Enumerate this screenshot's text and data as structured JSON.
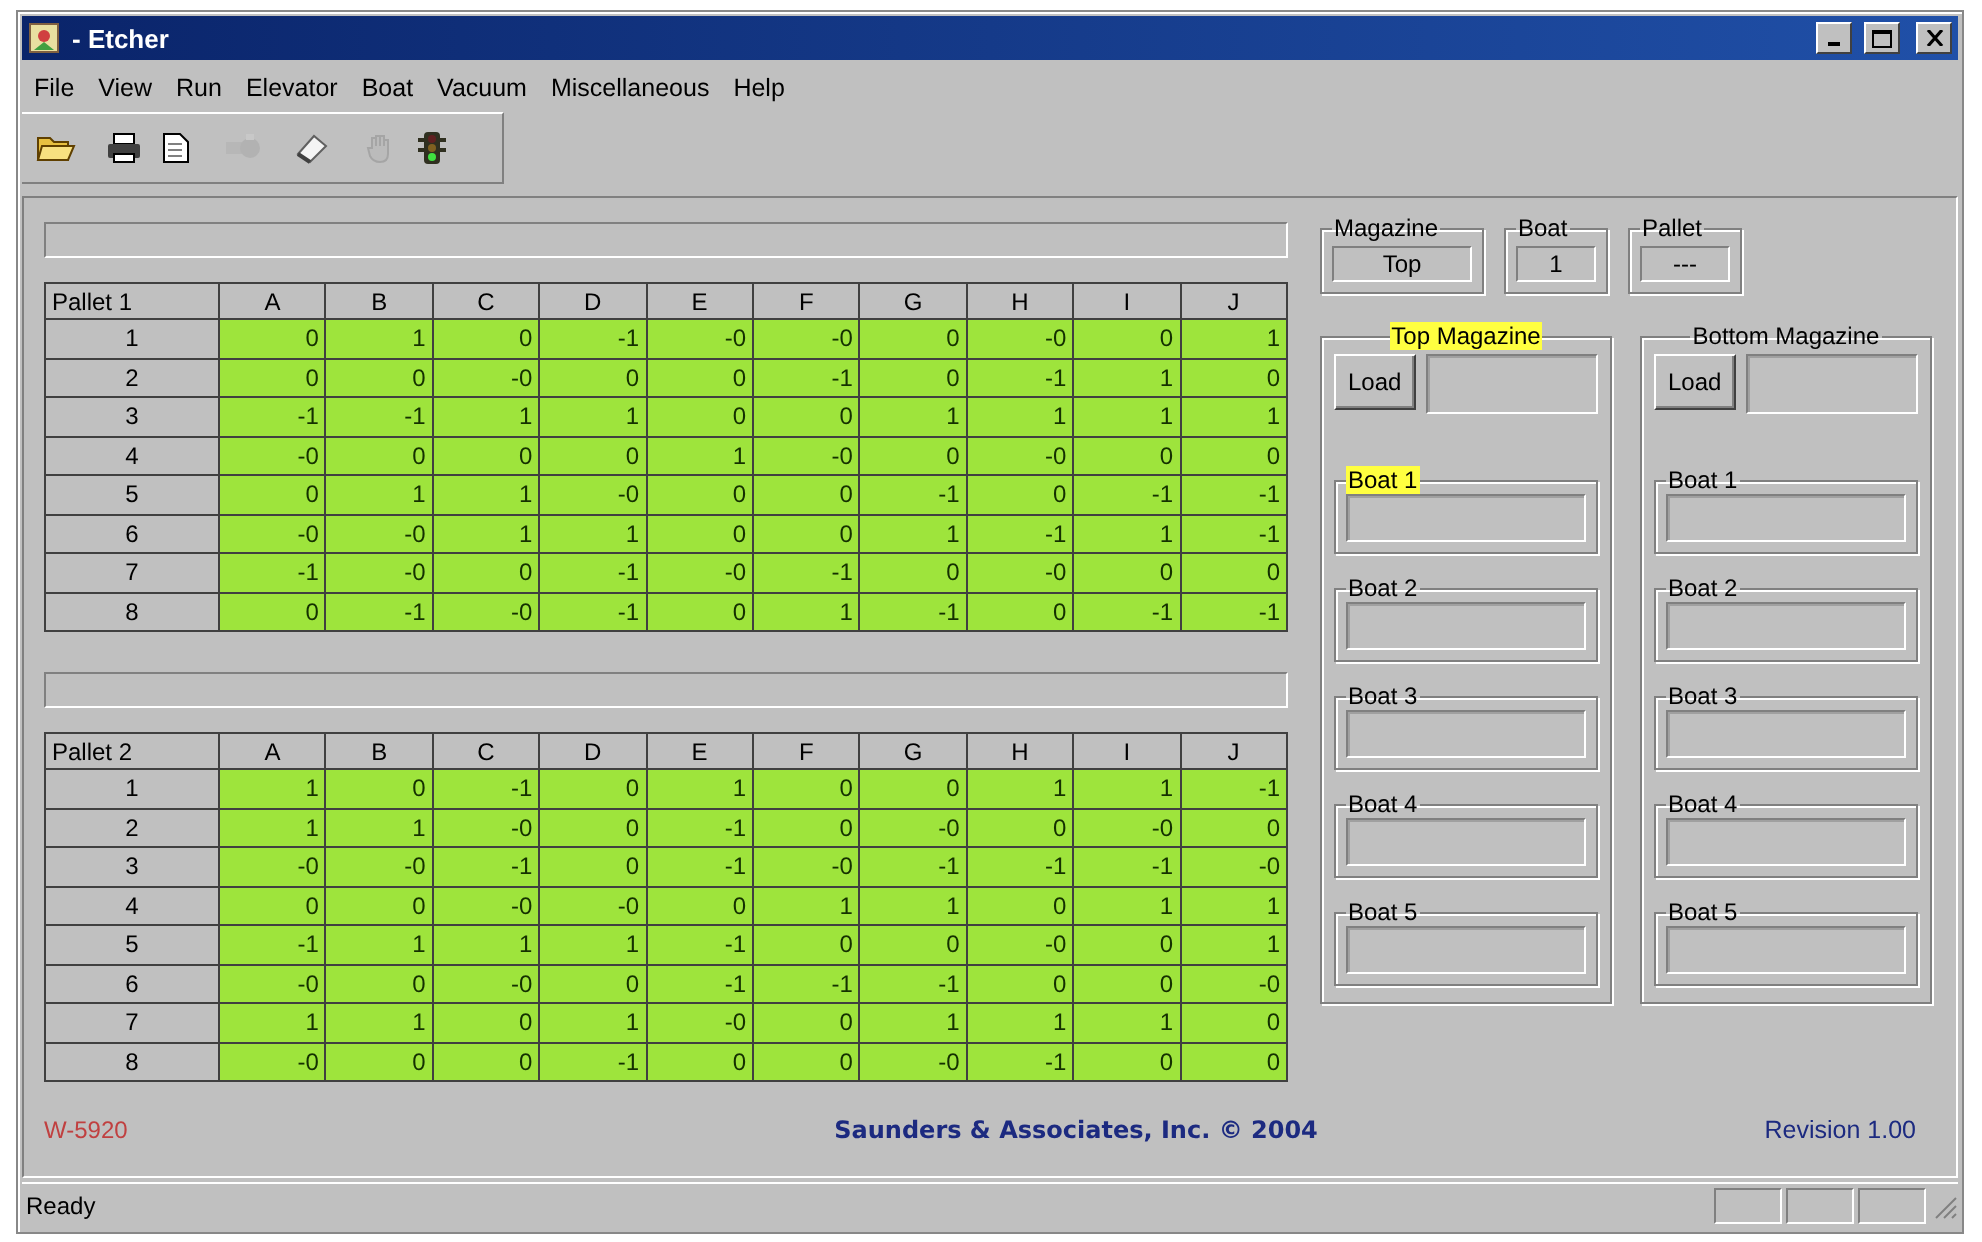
{
  "window": {
    "title": "- Etcher"
  },
  "menu": [
    "File",
    "View",
    "Run",
    "Elevator",
    "Boat",
    "Vacuum",
    "Miscellaneous",
    "Help"
  ],
  "toolbar": [
    {
      "kind": "open",
      "disabled": false
    },
    {
      "kind": "print",
      "disabled": false
    },
    {
      "kind": "document",
      "disabled": false
    },
    {
      "kind": "valve",
      "disabled": true
    },
    {
      "kind": "eraser",
      "disabled": false
    },
    {
      "kind": "hand",
      "disabled": true
    },
    {
      "kind": "traffic-light",
      "disabled": false
    }
  ],
  "pallets": [
    {
      "title": "Pallet 1",
      "columns": [
        "A",
        "B",
        "C",
        "D",
        "E",
        "F",
        "G",
        "H",
        "I",
        "J"
      ],
      "rows": [
        {
          "label": "1",
          "cells": [
            "0",
            "1",
            "0",
            "-1",
            "-0",
            "-0",
            "0",
            "-0",
            "0",
            "1"
          ]
        },
        {
          "label": "2",
          "cells": [
            "0",
            "0",
            "-0",
            "0",
            "0",
            "-1",
            "0",
            "-1",
            "1",
            "0"
          ]
        },
        {
          "label": "3",
          "cells": [
            "-1",
            "-1",
            "1",
            "1",
            "0",
            "0",
            "1",
            "1",
            "1",
            "1"
          ]
        },
        {
          "label": "4",
          "cells": [
            "-0",
            "0",
            "0",
            "0",
            "1",
            "-0",
            "0",
            "-0",
            "0",
            "0"
          ]
        },
        {
          "label": "5",
          "cells": [
            "0",
            "1",
            "1",
            "-0",
            "0",
            "0",
            "-1",
            "0",
            "-1",
            "-1"
          ]
        },
        {
          "label": "6",
          "cells": [
            "-0",
            "-0",
            "1",
            "1",
            "0",
            "0",
            "1",
            "-1",
            "1",
            "-1"
          ]
        },
        {
          "label": "7",
          "cells": [
            "-1",
            "-0",
            "0",
            "-1",
            "-0",
            "-1",
            "0",
            "-0",
            "0",
            "0"
          ]
        },
        {
          "label": "8",
          "cells": [
            "0",
            "-1",
            "-0",
            "-1",
            "0",
            "1",
            "-1",
            "0",
            "-1",
            "-1"
          ]
        }
      ]
    },
    {
      "title": "Pallet 2",
      "columns": [
        "A",
        "B",
        "C",
        "D",
        "E",
        "F",
        "G",
        "H",
        "I",
        "J"
      ],
      "rows": [
        {
          "label": "1",
          "cells": [
            "1",
            "0",
            "-1",
            "0",
            "1",
            "0",
            "0",
            "1",
            "1",
            "-1"
          ]
        },
        {
          "label": "2",
          "cells": [
            "1",
            "1",
            "-0",
            "0",
            "-1",
            "0",
            "-0",
            "0",
            "-0",
            "0"
          ]
        },
        {
          "label": "3",
          "cells": [
            "-0",
            "-0",
            "-1",
            "0",
            "-1",
            "-0",
            "-1",
            "-1",
            "-1",
            "-0"
          ]
        },
        {
          "label": "4",
          "cells": [
            "0",
            "0",
            "-0",
            "-0",
            "0",
            "1",
            "1",
            "0",
            "1",
            "1"
          ]
        },
        {
          "label": "5",
          "cells": [
            "-1",
            "1",
            "1",
            "1",
            "-1",
            "0",
            "0",
            "-0",
            "0",
            "1"
          ]
        },
        {
          "label": "6",
          "cells": [
            "-0",
            "0",
            "-0",
            "0",
            "-1",
            "-1",
            "-1",
            "0",
            "0",
            "-0"
          ]
        },
        {
          "label": "7",
          "cells": [
            "1",
            "1",
            "0",
            "1",
            "-0",
            "0",
            "1",
            "1",
            "1",
            "0"
          ]
        },
        {
          "label": "8",
          "cells": [
            "-0",
            "0",
            "0",
            "-1",
            "0",
            "0",
            "-0",
            "-1",
            "0",
            "0"
          ]
        }
      ]
    }
  ],
  "indicators": [
    {
      "label": "Magazine",
      "value": "Top"
    },
    {
      "label": "Boat",
      "value": "1"
    },
    {
      "label": "Pallet",
      "value": "---"
    }
  ],
  "magazines": [
    {
      "title": "Top Magazine",
      "highlighted": true,
      "button": "Load",
      "boats": [
        {
          "label": "Boat 1",
          "highlighted": true
        },
        {
          "label": "Boat 2",
          "highlighted": false
        },
        {
          "label": "Boat 3",
          "highlighted": false
        },
        {
          "label": "Boat 4",
          "highlighted": false
        },
        {
          "label": "Boat 5",
          "highlighted": false
        }
      ]
    },
    {
      "title": "Bottom Magazine",
      "highlighted": false,
      "button": "Load",
      "boats": [
        {
          "label": "Boat 1",
          "highlighted": false
        },
        {
          "label": "Boat 2",
          "highlighted": false
        },
        {
          "label": "Boat 3",
          "highlighted": false
        },
        {
          "label": "Boat 4",
          "highlighted": false
        },
        {
          "label": "Boat 5",
          "highlighted": false
        }
      ]
    }
  ],
  "footer": {
    "code": "W-5920",
    "copyright": "Saunders & Associates, Inc.  © 2004",
    "revision": "Revision 1.00"
  },
  "status_bar": {
    "text": "Ready"
  }
}
